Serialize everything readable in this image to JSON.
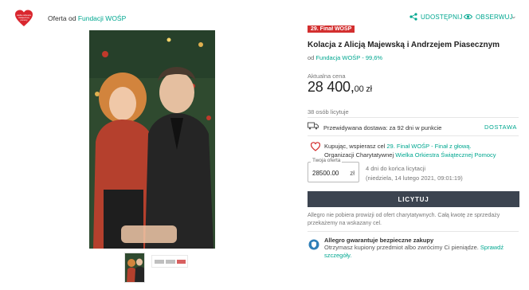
{
  "header": {
    "logo_text": "wielka orkiestra świątecznej pomocy",
    "offer_prefix": "Oferta od",
    "offer_link": "Fundacji WOŚP"
  },
  "actions": {
    "share_label": "UDOSTĘPNIJ",
    "observe_label": "OBSERWUJ",
    "more_icon": "chevron-down-icon"
  },
  "offer": {
    "badge": "29. Finał WOŚP",
    "title": "Kolacja z Alicją Majewską i Andrzejem Piasecznym",
    "from_prefix": "od",
    "from_link": "Fundacja WOŚP - 99,6%",
    "price_label": "Aktualna cena",
    "price_main": "28 400,",
    "price_cents": "00 zł",
    "bidders": "38 osób licytuje"
  },
  "delivery": {
    "text": "Przewidywana dostawa: za 92 dni w punkcie",
    "link": "DOSTAWA"
  },
  "charity": {
    "text_1": "Kupując, wspierasz cel",
    "link_1": "29. Finał WOŚP - Finał z głową.",
    "text_2": "Organizacji Charytatywnej",
    "link_2": "Wielka Orkiestra Świątecznej Pomocy"
  },
  "bid": {
    "field_label": "Twoja oferta",
    "value": "28500.00",
    "unit": "zł",
    "ends_line_1": "4 dni do końca licytacji",
    "ends_line_2": "(niedziela, 14 lutego 2021, 09:01:19)",
    "button": "LICYTUJ"
  },
  "note": "Allegro nie pobiera prowizji od ofert charytatywnych. Całą kwotę ze sprzedaży przekażemy na wskazany cel.",
  "guarantee": {
    "title": "Allegro gwarantuje bezpieczne zakupy",
    "text": "Otrzymasz kupiony przedmiot albo zwrócimy Ci pieniądze.",
    "link": "Sprawdź szczegóły."
  },
  "colors": {
    "accent": "#00a790",
    "badge": "#d32f2f",
    "button": "#3c4450"
  }
}
